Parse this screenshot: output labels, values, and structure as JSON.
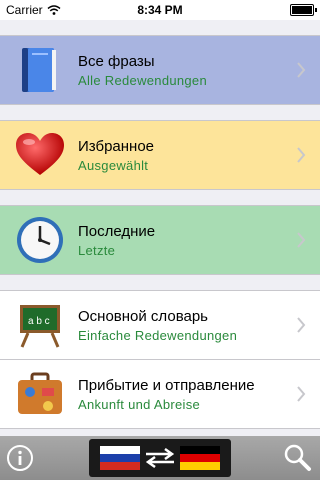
{
  "status_bar": {
    "carrier": "Carrier",
    "time": "8:34 PM"
  },
  "rows": [
    {
      "title": "Все фразы",
      "subtitle": "Alle Redewendungen",
      "background": "#a8b4e0",
      "icon": "book-icon"
    },
    {
      "title": "Избранное",
      "subtitle": "Ausgewählt",
      "background": "#fde49a",
      "icon": "heart-icon"
    },
    {
      "title": "Последние",
      "subtitle": "Letzte",
      "background": "#a8dcb3",
      "icon": "clock-icon"
    },
    {
      "title": "Основной словарь",
      "subtitle": "Einfache Redewendungen",
      "background": "#ffffff",
      "icon": "chalkboard-icon"
    },
    {
      "title": "Прибытие и отправление",
      "subtitle": "Ankunft und Abreise",
      "background": "#ffffff",
      "icon": "suitcase-icon"
    }
  ],
  "toolbar": {
    "info_icon": "info-icon",
    "language_switch": {
      "from": "russia-flag-icon",
      "to": "germany-flag-icon",
      "arrows": "swap-arrows-icon"
    },
    "search_icon": "search-icon"
  },
  "colors": {
    "subtitle_text": "#2a8a3c",
    "separator": "#c8c7cc",
    "toolbar": "#9a9a9a"
  }
}
